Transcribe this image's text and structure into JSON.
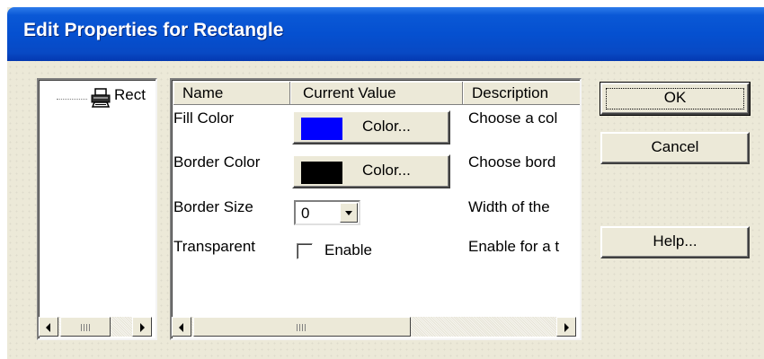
{
  "window": {
    "title": "Edit Properties for Rectangle"
  },
  "tree": {
    "items": [
      {
        "label": "Rectangle",
        "visible_label": "Rect",
        "icon": "printer-icon"
      }
    ]
  },
  "grid": {
    "columns": [
      "Name",
      "Current Value",
      "Description"
    ],
    "rows": [
      {
        "name": "Fill Color",
        "value_swatch": "#0000ff",
        "button_label": "Color...",
        "description": "Choose a col"
      },
      {
        "name": "Border Color",
        "value_swatch": "#000000",
        "button_label": "Color...",
        "description": "Choose bord"
      },
      {
        "name": "Border Size",
        "select_value": "0",
        "description": "Width of the"
      },
      {
        "name": "Transparent",
        "checkbox_label": "Enable",
        "checked": false,
        "description": "Enable for a t"
      }
    ]
  },
  "buttons": {
    "ok": "OK",
    "cancel": "Cancel",
    "help": "Help..."
  },
  "colors": {
    "titlebar": "#0550d0",
    "dialog_bg": "#ece9d8"
  }
}
